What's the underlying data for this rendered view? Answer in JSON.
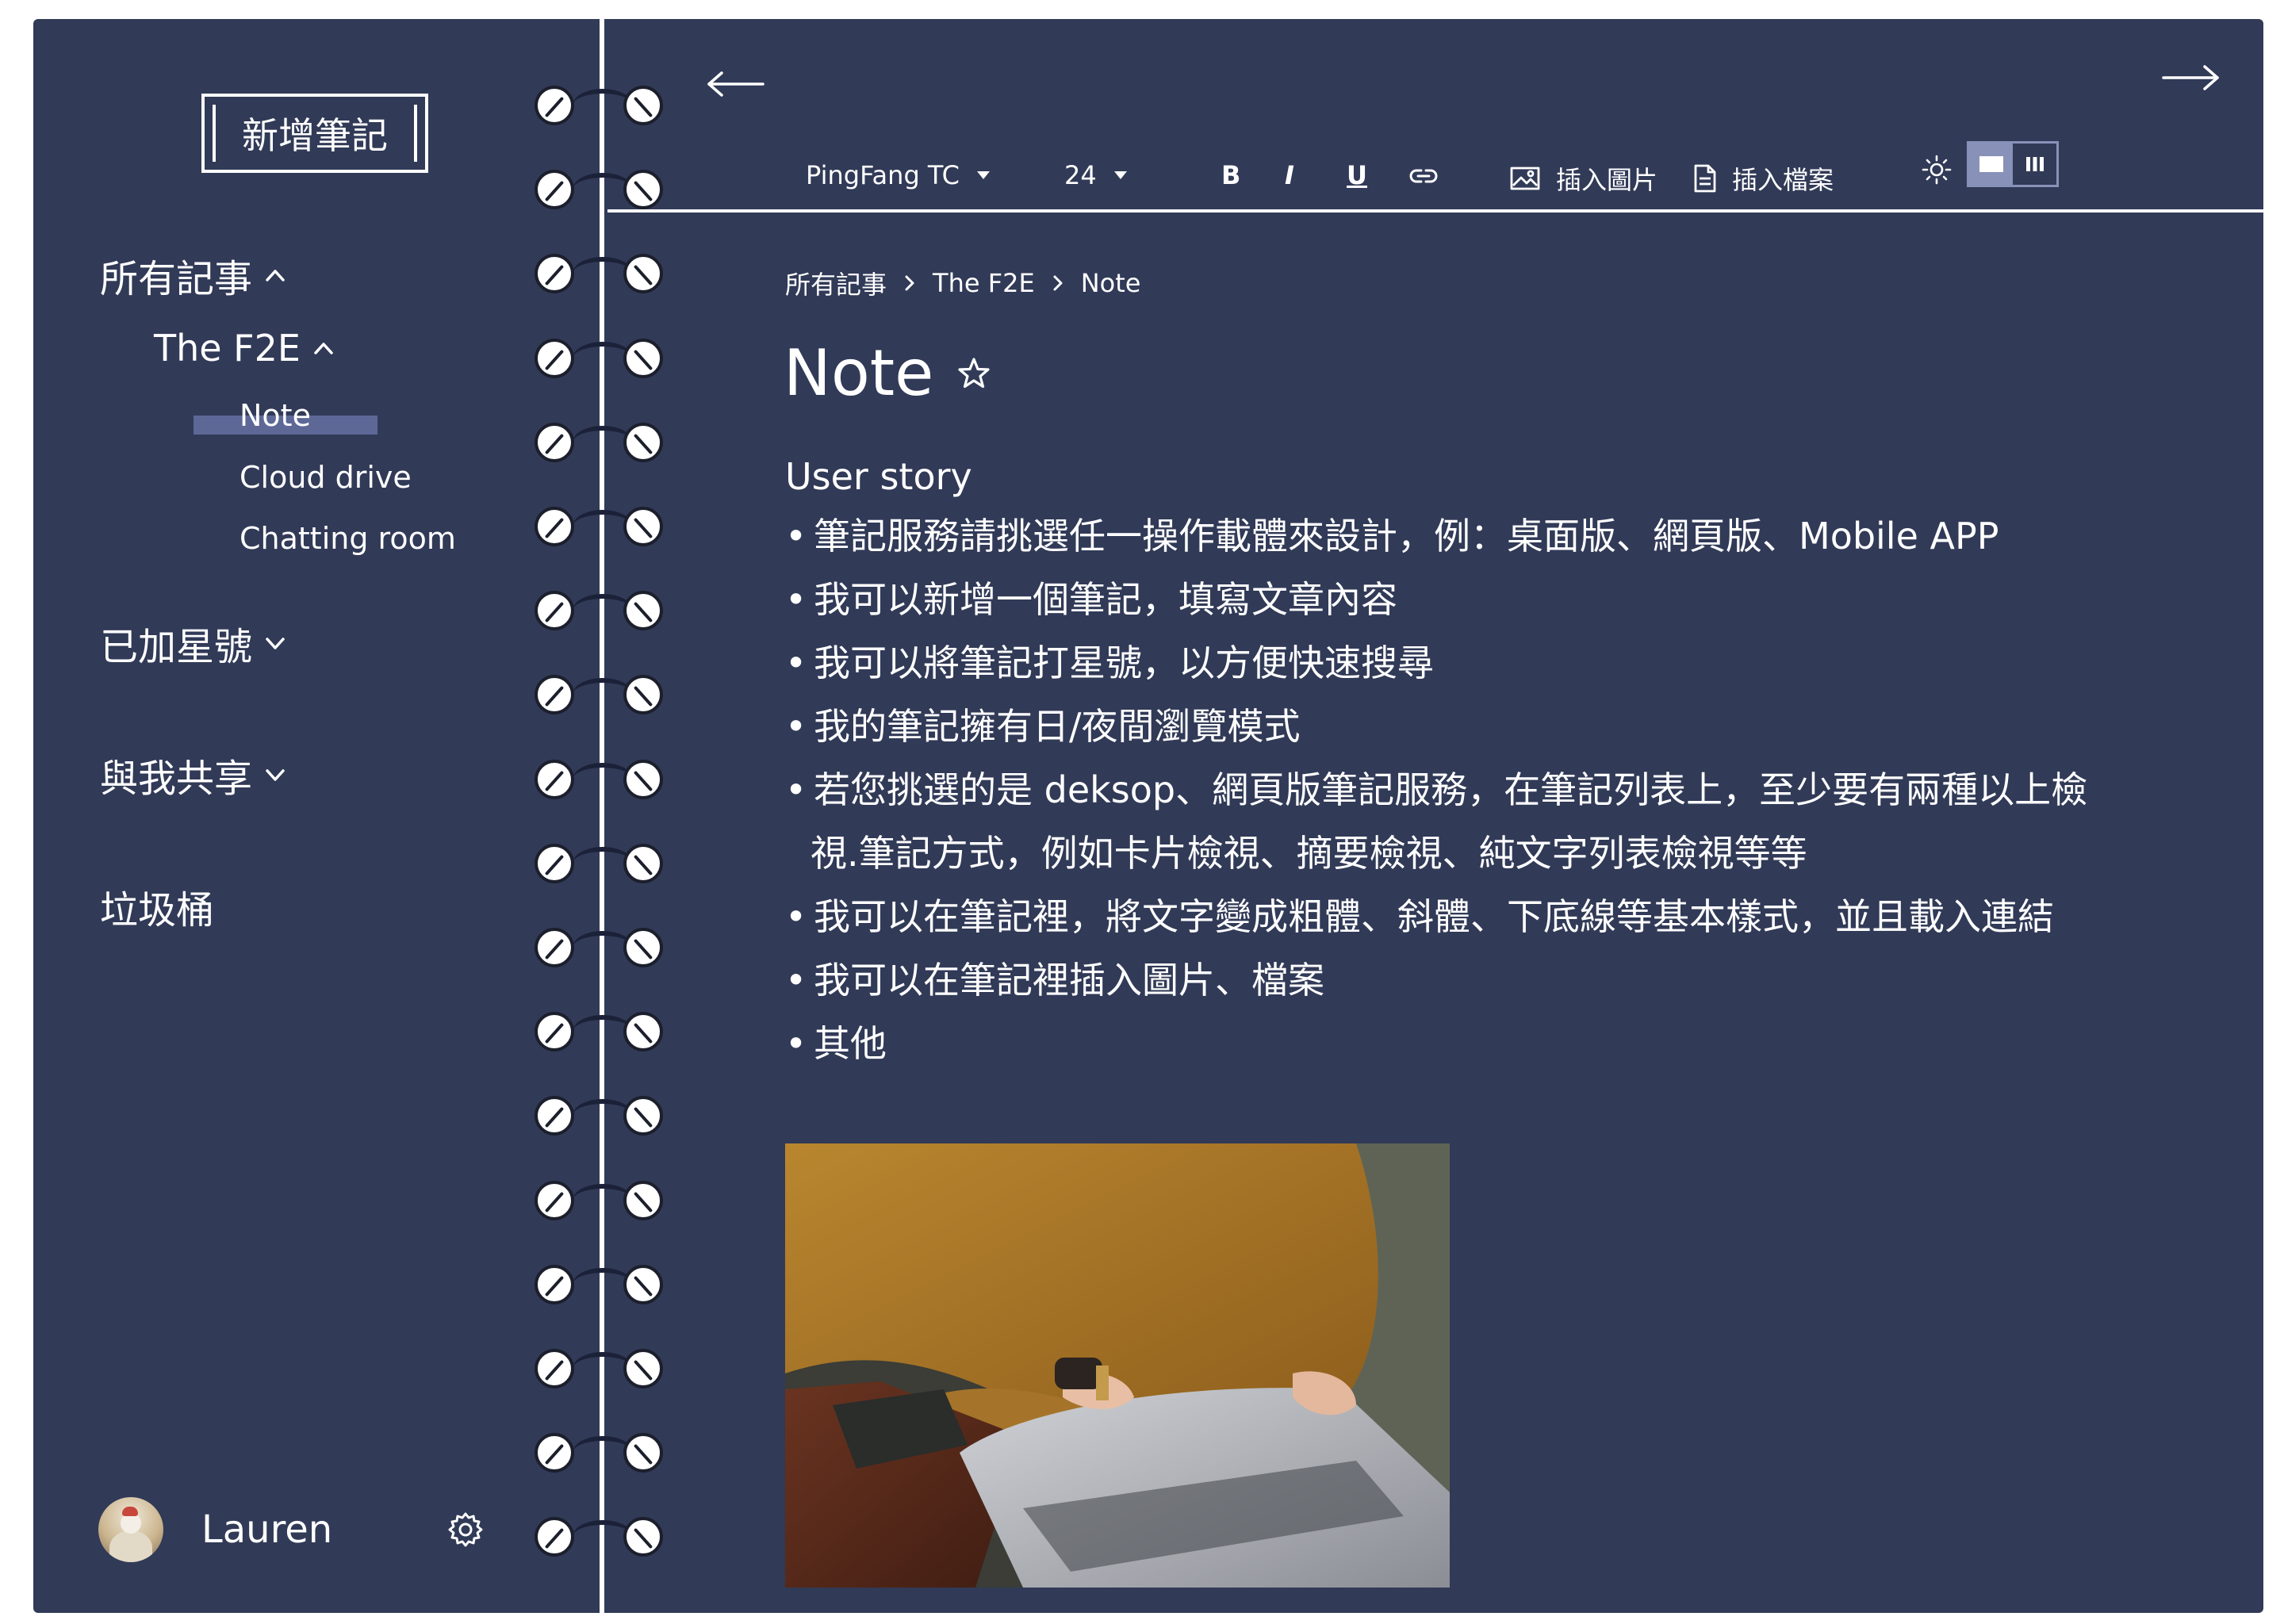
{
  "sidebar": {
    "new_note_label": "新增筆記",
    "all_notes": "所有記事",
    "notebook": "The F2E",
    "notes": [
      "Note",
      "Cloud drive",
      "Chatting room"
    ],
    "starred": "已加星號",
    "shared": "與我共享",
    "trash": "垃圾桶",
    "user_name": "Lauren"
  },
  "toolbar": {
    "font_family": "PingFang TC",
    "font_size": "24",
    "bold": "B",
    "italic": "I",
    "underline": "U",
    "insert_image": "插入圖片",
    "insert_file": "插入檔案"
  },
  "breadcrumb": [
    "所有記事",
    "The F2E",
    "Note"
  ],
  "note": {
    "title": "Note",
    "heading": "User story",
    "bullets": [
      "筆記服務請挑選任一操作載體來設計，例：桌面版、網頁版、Mobile APP",
      "我可以新增一個筆記，填寫文章內容",
      "我可以將筆記打星號，以方便快速搜尋",
      "我的筆記擁有日/夜間瀏覽模式",
      "若您挑選的是 deksop、網頁版筆記服務，在筆記列表上，至少要有兩種以上檢",
      "我可以在筆記裡，將文字變成粗體、斜體、下底線等基本樣式，並且載入連結",
      "我可以在筆記裡插入圖片、檔案",
      "其他"
    ],
    "bullet_4_continuation": "視.筆記方式，例如卡片檢視、摘要檢視、純文字列表檢視等等"
  },
  "colors": {
    "background": "#313a57",
    "highlight": "#5d6897",
    "toggle": "#8891b8"
  }
}
